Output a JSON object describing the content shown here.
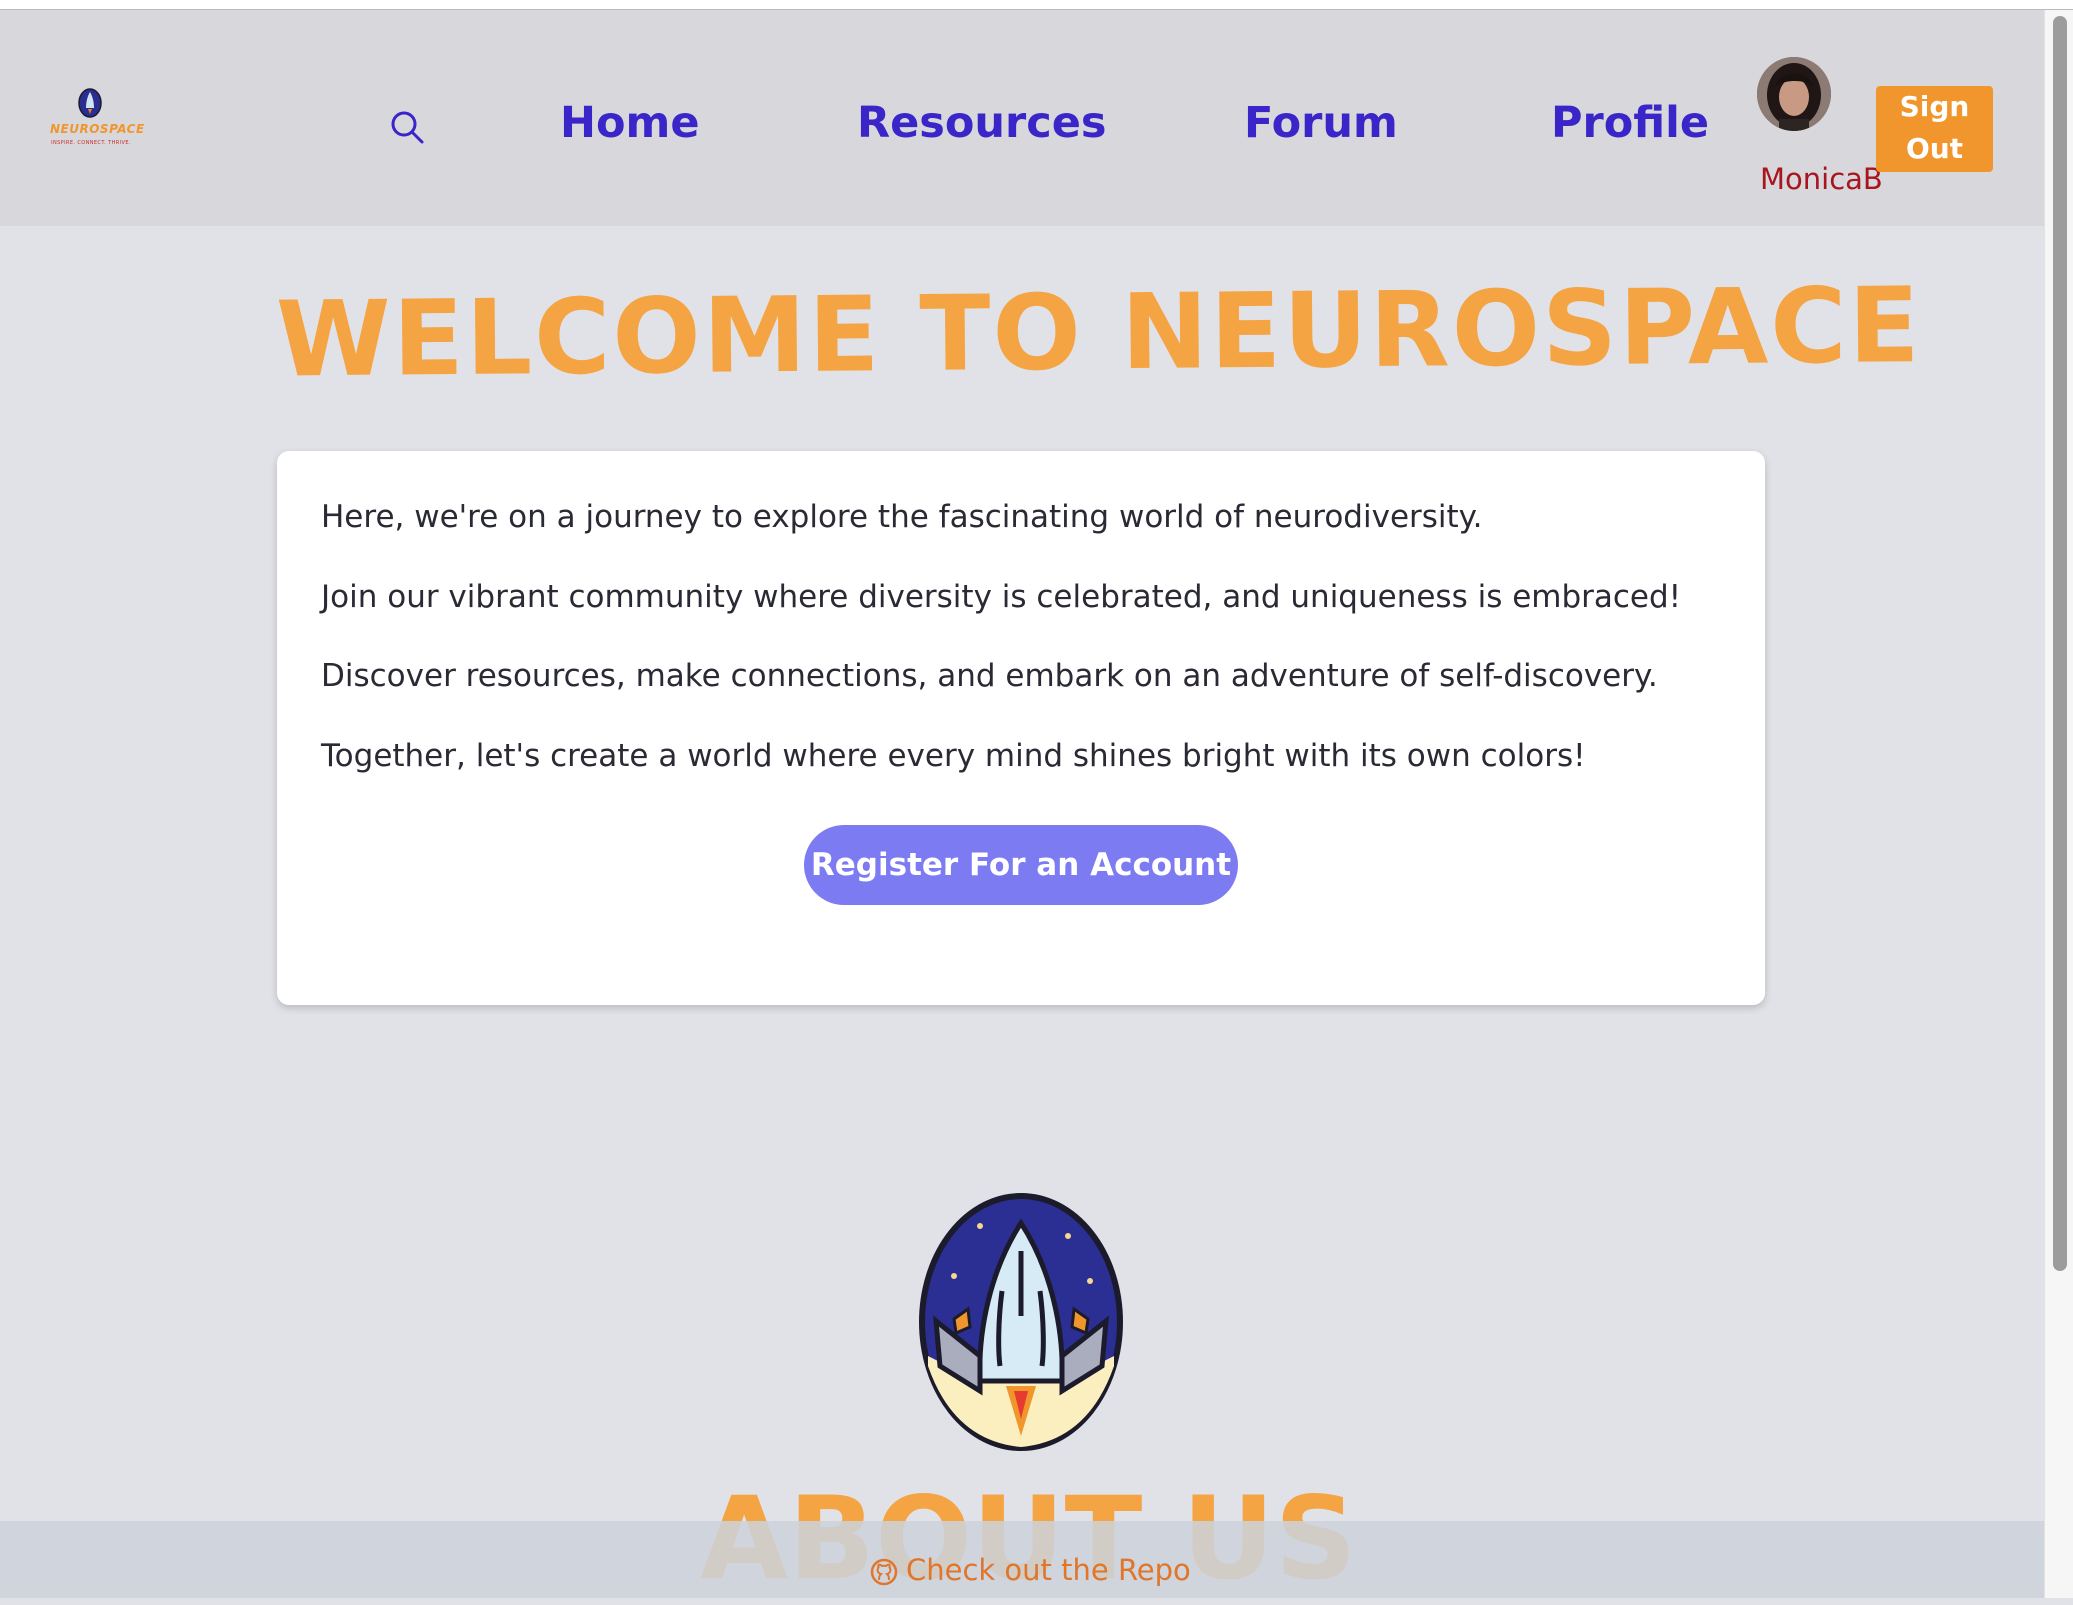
{
  "brand": {
    "name": "NEUROSPACE",
    "tagline": "INSPIRE. CONNECT. THRIVE.",
    "accent_orange": "#f5a443",
    "nav_color": "#3a25c9"
  },
  "nav": {
    "search_icon": "search-icon",
    "items": [
      {
        "label": "Home"
      },
      {
        "label": "Resources"
      },
      {
        "label": "Forum"
      },
      {
        "label": "Profile"
      }
    ]
  },
  "user": {
    "username": "MonicaB",
    "signout_label": "Sign Out"
  },
  "hero": {
    "title": "WELCOME TO NEUROSPACE"
  },
  "intro": {
    "paragraphs": [
      "Here, we're on a journey to explore the fascinating world of neurodiversity.",
      "Join our vibrant community where diversity is celebrated, and uniqueness is embraced!",
      "Discover resources, make connections, and embark on an adventure of self-discovery.",
      "Together, let's create a world where every mind shines bright with its own colors!"
    ],
    "register_label": "Register For an Account"
  },
  "about": {
    "title": "ABOUT US"
  },
  "footer": {
    "repo_label": "Check out the Repo",
    "repo_icon": "github-icon"
  }
}
